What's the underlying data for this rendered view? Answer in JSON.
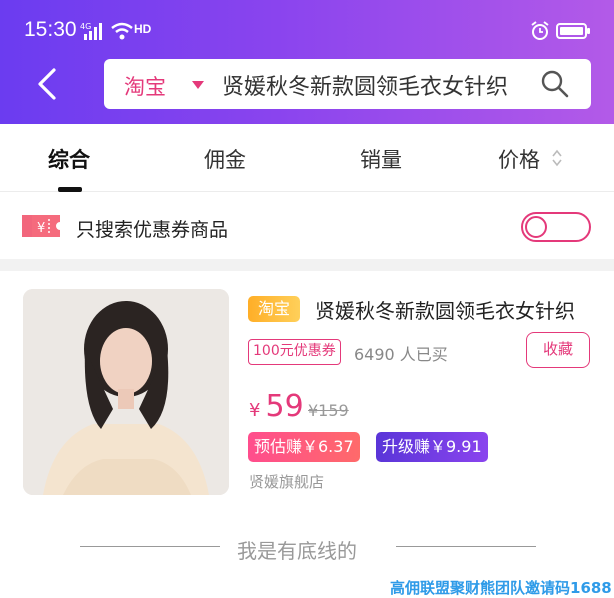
{
  "status_bar": {
    "time": "15:30",
    "network": "HD"
  },
  "search": {
    "platform": "淘宝",
    "query": "贤媛秋冬新款圆领毛衣女针织"
  },
  "tabs": [
    {
      "label": "综合",
      "active": true
    },
    {
      "label": "佣金",
      "active": false
    },
    {
      "label": "销量",
      "active": false
    },
    {
      "label": "价格",
      "active": false
    }
  ],
  "coupon_filter": {
    "label": "只搜索优惠券商品",
    "enabled": false
  },
  "product": {
    "platform_badge": "淘宝",
    "title": "贤媛秋冬新款圆领毛衣女针织",
    "coupon": "100元优惠券",
    "sold": "6490 人已买",
    "favorite_label": "收藏",
    "currency": "¥",
    "price": "59",
    "original_price": "¥159",
    "estimated_earn": "预估赚￥6.37",
    "upgrade_earn": "升级赚￥9.91",
    "shop": "贤媛旗舰店"
  },
  "footer": {
    "end_text": "我是有底线的"
  },
  "watermark": "高佣联盟聚财熊团队邀请码1688",
  "colors": {
    "accent": "#e4397a",
    "header_start": "#6b3cf0",
    "header_end": "#b35ae8"
  },
  "icons": [
    "signal-icon",
    "wifi-icon",
    "alarm-icon",
    "battery-icon",
    "back-arrow-icon",
    "search-icon",
    "sort-icon",
    "coupon-icon"
  ]
}
